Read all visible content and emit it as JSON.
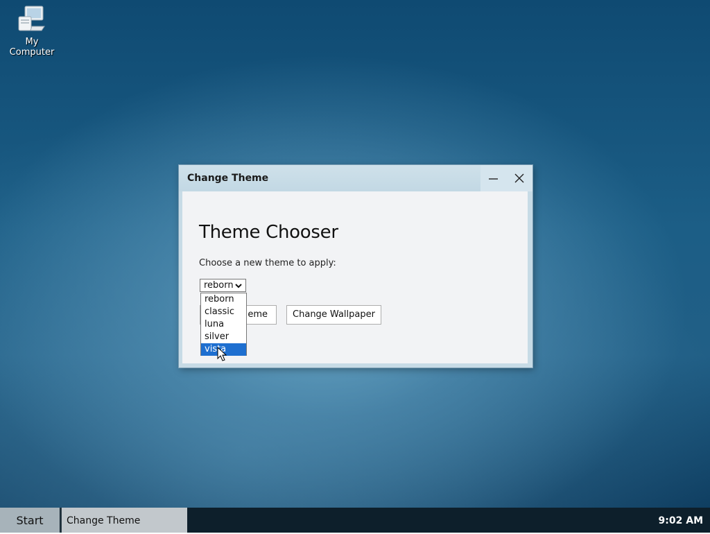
{
  "desktop": {
    "icons": [
      {
        "label": "My Computer",
        "icon": "computer-icon"
      }
    ]
  },
  "window": {
    "title": "Change Theme",
    "controls": {
      "minimize": "minimize-icon",
      "close": "close-icon"
    },
    "heading": "Theme Chooser",
    "description": "Choose a new theme to apply:",
    "theme_select": {
      "value": "reborn",
      "options": [
        "reborn",
        "classic",
        "luna",
        "silver",
        "vista"
      ],
      "highlighted": "vista"
    },
    "buttons": {
      "apply_label": "Apply Theme",
      "apply_visible_label": "eme",
      "wallpaper_label": "Change Wallpaper"
    }
  },
  "taskbar": {
    "start_label": "Start",
    "tasks": [
      {
        "label": "Change Theme"
      }
    ],
    "clock": "9:02 AM"
  },
  "colors": {
    "selection": "#1e6fd0",
    "taskbar": "#0d1f2b",
    "titlebar": "#c7dbe6"
  }
}
